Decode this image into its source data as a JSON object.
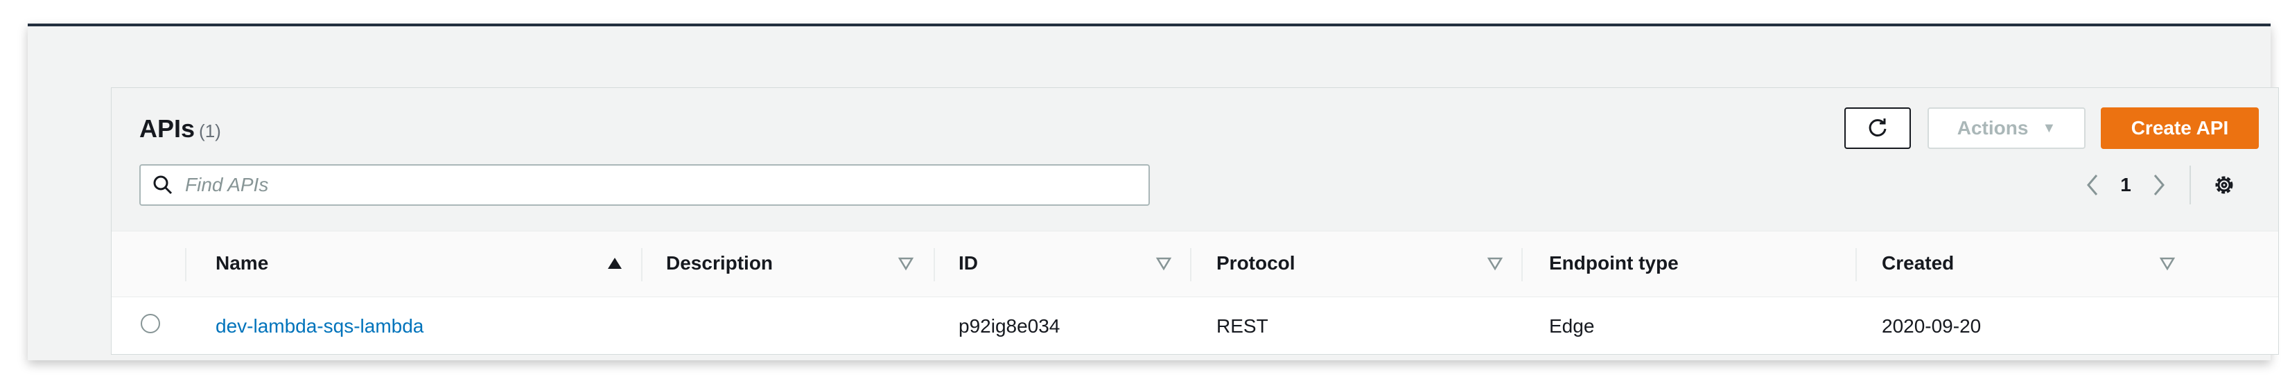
{
  "page": {
    "title": "APIs",
    "count": "(1)"
  },
  "toolbar": {
    "refresh_icon": "refresh-icon",
    "actions_label": "Actions",
    "actions_caret": "caret-down-icon",
    "create_label": "Create API"
  },
  "search": {
    "placeholder": "Find APIs",
    "value": ""
  },
  "pagination": {
    "current_page": "1"
  },
  "table": {
    "columns": [
      {
        "label": "Name",
        "sort": "ascending"
      },
      {
        "label": "Description",
        "sort": "none"
      },
      {
        "label": "ID",
        "sort": "none"
      },
      {
        "label": "Protocol",
        "sort": "none"
      },
      {
        "label": "Endpoint type",
        "sort": "none"
      },
      {
        "label": "Created",
        "sort": "none"
      }
    ],
    "rows": [
      {
        "name": "dev-lambda-sqs-lambda",
        "description": "",
        "id": "p92ig8e034",
        "protocol": "REST",
        "endpoint_type": "Edge",
        "created": "2020-09-20",
        "selected": false
      }
    ]
  },
  "colors": {
    "primary": "#ec7211",
    "link": "#0073bb",
    "header_bar": "#232f3e"
  }
}
